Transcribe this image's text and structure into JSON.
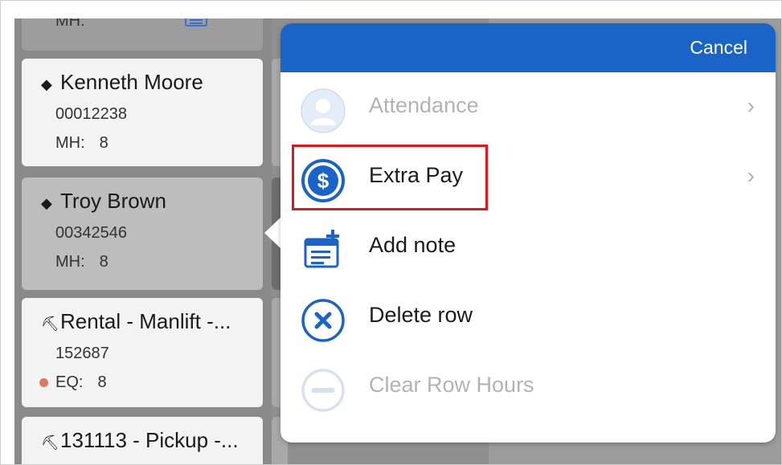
{
  "left_list": {
    "cards": [
      {
        "mh_label": "MH:",
        "mh_value": ""
      },
      {
        "icon": "worker-hardhat-icon",
        "name": "Kenneth Moore",
        "number": "00012238",
        "mh_label": "MH:",
        "mh_value": "8"
      },
      {
        "icon": "worker-hardhat-icon",
        "name": "Troy Brown",
        "number": "00342546",
        "mh_label": "MH:",
        "mh_value": "8"
      },
      {
        "icon": "excavator-icon",
        "name": "Rental - Manlift -...",
        "number": "152687",
        "mh_label": "EQ:",
        "mh_value": "8",
        "status_color": "#e07a5f"
      },
      {
        "icon": "excavator-icon",
        "name": "131113 - Pickup -..."
      }
    ]
  },
  "popover": {
    "cancel_label": "Cancel",
    "header_color": "#1a64c8",
    "items": [
      {
        "label": "Attendance",
        "icon": "person-avatar-icon",
        "disabled": true,
        "chevron": "›"
      },
      {
        "label": "Extra Pay",
        "icon": "dollar-circle-icon",
        "disabled": false,
        "chevron": "›",
        "highlighted": true
      },
      {
        "label": "Add note",
        "icon": "add-note-icon",
        "disabled": false
      },
      {
        "label": "Delete row",
        "icon": "close-circle-icon",
        "disabled": false
      },
      {
        "label": "Clear Row Hours",
        "icon": "minus-circle-icon",
        "disabled": true
      }
    ]
  }
}
